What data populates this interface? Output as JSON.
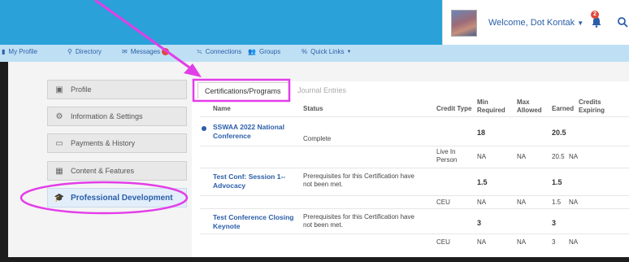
{
  "header": {
    "welcome": "Welcome, Dot Kontak",
    "notification_count": "2"
  },
  "nav": {
    "items": [
      "My Profile",
      "Directory",
      "Messages",
      "Connections",
      "Groups",
      "Quick Links"
    ]
  },
  "sidebar": {
    "items": [
      "Profile",
      "Information & Settings",
      "Payments & History",
      "Content & Features",
      "Professional Development"
    ],
    "active_index": 4
  },
  "tabs": [
    "Certifications/Programs",
    "Journal Entries"
  ],
  "table": {
    "headers": {
      "name": "Name",
      "status": "Status",
      "credit_type": "Credit Type",
      "min_required": "Min Required",
      "max_allowed": "Max Allowed",
      "earned": "Earned",
      "credits_expiring": "Credits Expiring"
    },
    "rows": [
      {
        "name": "SSWAA 2022 National Conference",
        "status": "Complete",
        "min": "18",
        "earned": "20.5",
        "sub": {
          "credit_type": "Live In Person",
          "min": "NA",
          "max": "NA",
          "earned": "20.5",
          "expiring": "NA"
        }
      },
      {
        "name": "Test Conf: Session 1-- Advocacy",
        "status": "Prerequisites for this Certification have not been met.",
        "min": "1.5",
        "earned": "1.5",
        "sub": {
          "credit_type": "CEU",
          "min": "NA",
          "max": "NA",
          "earned": "1.5",
          "expiring": "NA"
        }
      },
      {
        "name": "Test Conference Closing Keynote",
        "status": "Prerequisites for this Certification have not been met.",
        "min": "3",
        "earned": "3",
        "sub": {
          "credit_type": "CEU",
          "min": "NA",
          "max": "NA",
          "earned": "3",
          "expiring": "NA"
        }
      }
    ]
  },
  "colors": {
    "top_bar": "#2aa1d8",
    "nav_bar": "#bfe0f4",
    "link": "#2b5ea8",
    "annotation_magenta": "#e23ee8"
  }
}
